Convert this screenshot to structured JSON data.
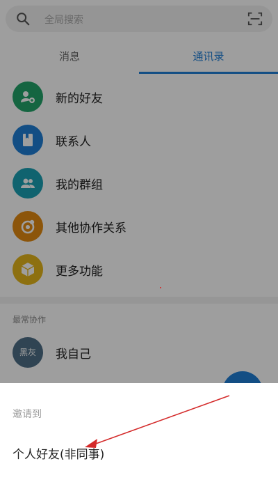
{
  "search": {
    "placeholder": "全局搜索",
    "icon": "search-icon",
    "scan_icon": "scan-icon"
  },
  "tabs": [
    {
      "label": "消息",
      "active": false
    },
    {
      "label": "通讯录",
      "active": true
    }
  ],
  "contacts_menu": [
    {
      "label": "新的好友",
      "icon": "add-user-icon",
      "color": "#23a46a"
    },
    {
      "label": "联系人",
      "icon": "contact-book-icon",
      "color": "#1f7ed6"
    },
    {
      "label": "我的群组",
      "icon": "group-icon",
      "color": "#1ba1b3"
    },
    {
      "label": "其他协作关系",
      "icon": "collaboration-icon",
      "color": "#e28a11"
    },
    {
      "label": "更多功能",
      "icon": "box-icon",
      "color": "#e4b51a"
    }
  ],
  "frequent": {
    "section_label": "最常协作",
    "me": {
      "avatar_text": "黑灰",
      "label": "我自己",
      "avatar_color": "#4e6e87"
    }
  },
  "sheet": {
    "title": "邀请到",
    "options": [
      {
        "label": "个人好友(非同事)"
      }
    ]
  },
  "colors": {
    "accent": "#1f7ed6",
    "annotation": "#d42a2a"
  }
}
